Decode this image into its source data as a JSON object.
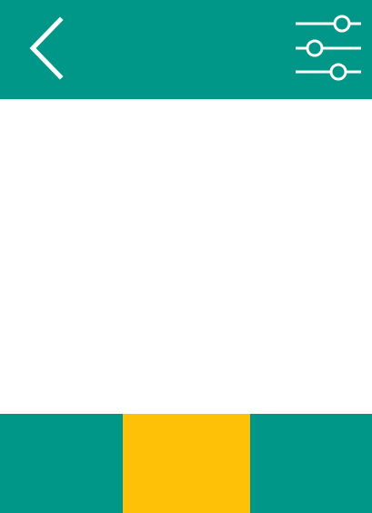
{
  "colors": {
    "primary": "#009688",
    "accent": "#ffc107",
    "background": "#ffffff",
    "icon": "#ffffff"
  },
  "header": {
    "back_icon": "chevron-left-icon",
    "filter_icon": "sliders-icon"
  },
  "bottom_bar": {
    "segments": [
      {
        "color": "#009688",
        "active": false
      },
      {
        "color": "#ffc107",
        "active": true
      },
      {
        "color": "#009688",
        "active": false
      }
    ]
  }
}
